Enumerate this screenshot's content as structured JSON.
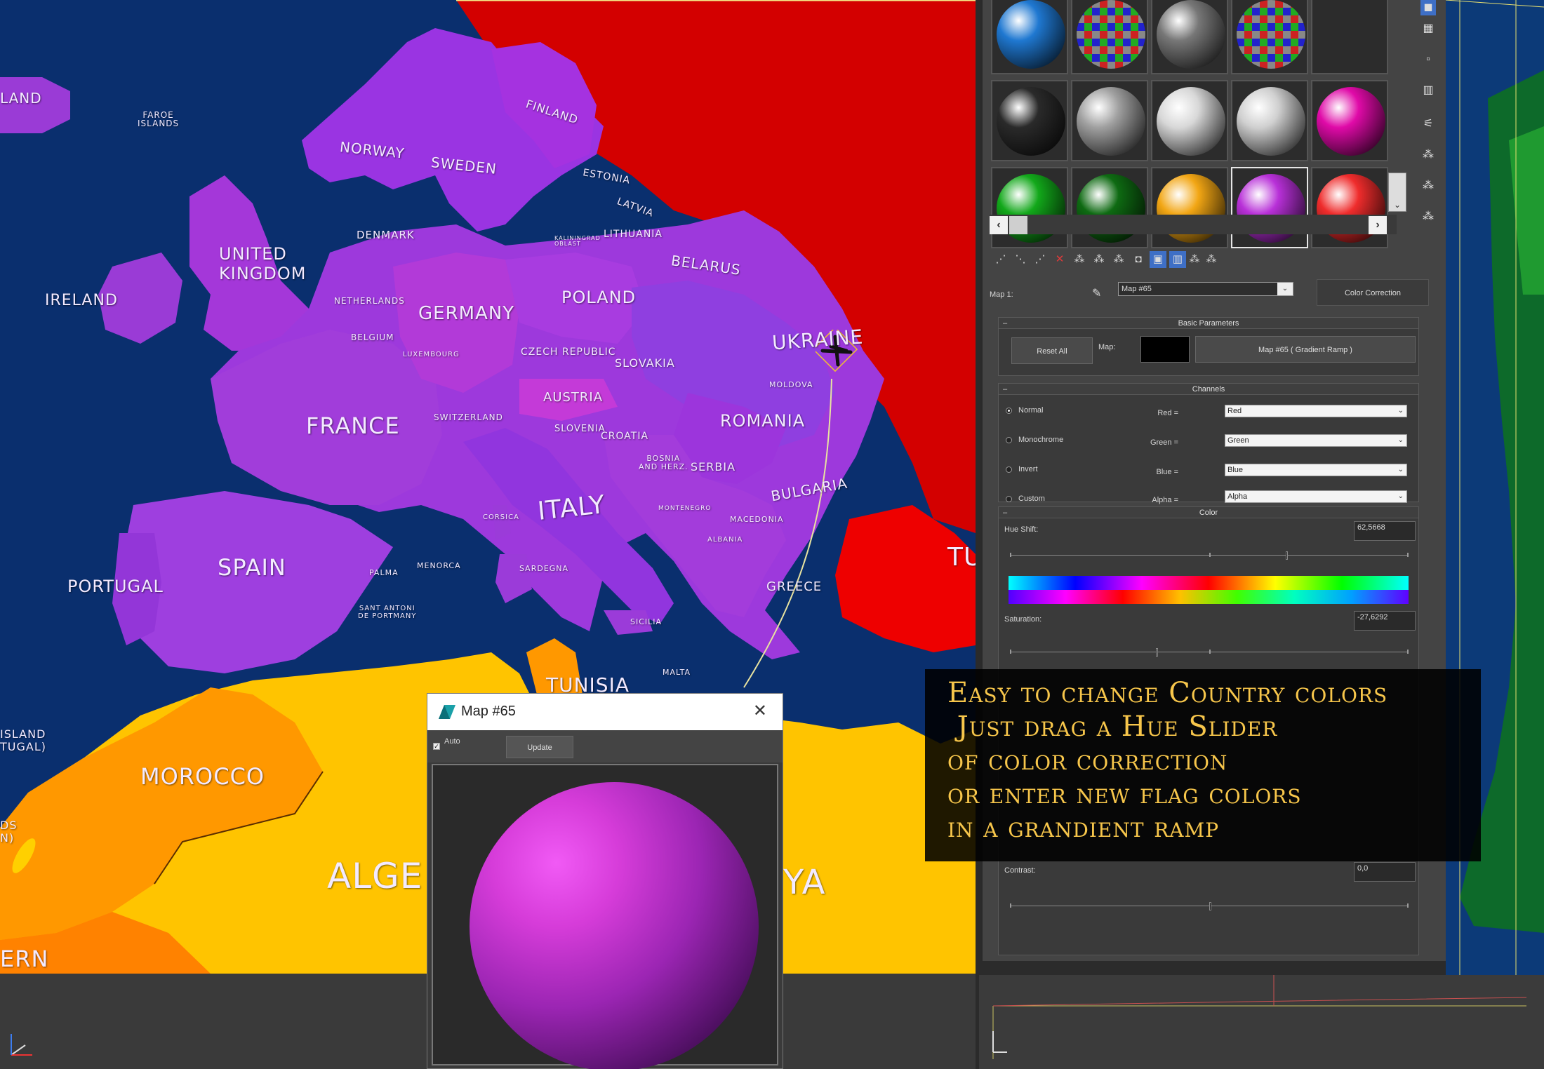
{
  "map": {
    "countries": [
      {
        "id": "iceland",
        "label": "LAND"
      },
      {
        "id": "faroe",
        "label": "FAROE\nISLANDS"
      },
      {
        "id": "norway",
        "label": "NORWAY"
      },
      {
        "id": "sweden",
        "label": "SWEDEN"
      },
      {
        "id": "finland",
        "label": "FINLAND"
      },
      {
        "id": "estonia",
        "label": "ESTONIA"
      },
      {
        "id": "latvia",
        "label": "LATVIA"
      },
      {
        "id": "lithuania",
        "label": "LITHUANIA"
      },
      {
        "id": "kaliningrad",
        "label": "KALININGRAD\nOBLAST"
      },
      {
        "id": "belarus",
        "label": "BELARUS"
      },
      {
        "id": "denmark",
        "label": "DENMARK"
      },
      {
        "id": "uk",
        "label": "UNITED\nKINGDOM"
      },
      {
        "id": "ireland",
        "label": "IRELAND"
      },
      {
        "id": "netherlands",
        "label": "NETHERLANDS"
      },
      {
        "id": "belgium",
        "label": "BELGIUM"
      },
      {
        "id": "luxembourg",
        "label": "LUXEMBOURG"
      },
      {
        "id": "germany",
        "label": "GERMANY"
      },
      {
        "id": "poland",
        "label": "POLAND"
      },
      {
        "id": "ukraine",
        "label": "UKRAINE"
      },
      {
        "id": "czech",
        "label": "CZECH REPUBLIC"
      },
      {
        "id": "slovakia",
        "label": "SLOVAKIA"
      },
      {
        "id": "austria",
        "label": "AUSTRIA"
      },
      {
        "id": "moldova",
        "label": "MOLDOVA"
      },
      {
        "id": "france",
        "label": "FRANCE"
      },
      {
        "id": "switzerland",
        "label": "SWITZERLAND"
      },
      {
        "id": "slovenia",
        "label": "SLOVENIA"
      },
      {
        "id": "croatia",
        "label": "CROATIA"
      },
      {
        "id": "romania",
        "label": "ROMANIA"
      },
      {
        "id": "bosnia",
        "label": "BOSNIA\nAND HERZ."
      },
      {
        "id": "serbia",
        "label": "SERBIA"
      },
      {
        "id": "bulgaria",
        "label": "BULGARIA"
      },
      {
        "id": "montenegro",
        "label": "MONTENEGRO"
      },
      {
        "id": "macedonia",
        "label": "MACEDONIA"
      },
      {
        "id": "albania",
        "label": "ALBANIA"
      },
      {
        "id": "italy",
        "label": "ITALY"
      },
      {
        "id": "corsica",
        "label": "CORSICA"
      },
      {
        "id": "sardegna",
        "label": "SARDEGNA"
      },
      {
        "id": "spain",
        "label": "SPAIN"
      },
      {
        "id": "portugal",
        "label": "PORTUGAL"
      },
      {
        "id": "palma",
        "label": "PALMA"
      },
      {
        "id": "menorca",
        "label": "MENORCA"
      },
      {
        "id": "sant-antoni",
        "label": "SANT ANTONI\nDE PORTMANY"
      },
      {
        "id": "sicilia",
        "label": "SICILIA"
      },
      {
        "id": "greece",
        "label": "GREECE"
      },
      {
        "id": "tunisia",
        "label": "TUNISIA"
      },
      {
        "id": "malta",
        "label": "MALTA"
      },
      {
        "id": "morocco",
        "label": "MOROCCO"
      },
      {
        "id": "algeria",
        "label": "ALGE"
      },
      {
        "id": "libya",
        "label": "YA"
      },
      {
        "id": "turkey",
        "label": "TU"
      },
      {
        "id": "madeira",
        "label": "ISLAND\nTUGAL)"
      },
      {
        "id": "canaries",
        "label": "DS\nN)"
      },
      {
        "id": "western",
        "label": "ERN"
      }
    ]
  },
  "slots": {
    "rows": [
      [
        "#1f78d1",
        "checker",
        "#777777",
        "checker",
        ""
      ],
      [
        "#2a2a2a",
        "#a0a0a0",
        "#d8d8d8",
        "#d0d0d0",
        "#e00aa8"
      ],
      [
        "#12a81a",
        "#0e6a12",
        "#f2a614",
        "#b830d8",
        "#ef2c2c"
      ]
    ]
  },
  "toolbar": {
    "map_label": "Map 1:",
    "map_value": "Map #65",
    "map_type_button": "Color Correction"
  },
  "basic_parameters": {
    "title": "Basic Parameters",
    "reset_all": "Reset All",
    "map_label": "Map:",
    "map_button": "Map #65  ( Gradient Ramp )"
  },
  "channels": {
    "title": "Channels",
    "modes": [
      "Normal",
      "Monochrome",
      "Invert",
      "Custom"
    ],
    "selected_mode": "Normal",
    "rows": [
      {
        "label": "Red =",
        "value": "Red"
      },
      {
        "label": "Green =",
        "value": "Green"
      },
      {
        "label": "Blue =",
        "value": "Blue"
      },
      {
        "label": "Alpha =",
        "value": "Alpha"
      }
    ]
  },
  "color": {
    "title": "Color",
    "hue_shift_label": "Hue Shift:",
    "hue_shift_value": "62,5668",
    "saturation_label": "Saturation:",
    "saturation_value": "-27,6292",
    "contrast_label": "Contrast:",
    "contrast_value": "0,0"
  },
  "promo": {
    "lines": [
      "Easy to change Country colors",
      " Just drag a Hue Slider",
      "of color correction",
      "or enter new flag colors",
      "in a grandient ramp"
    ]
  },
  "preview": {
    "title": "Map #65",
    "auto_label": "Auto",
    "auto_checked": true,
    "update_label": "Update",
    "close_glyph": "✕"
  },
  "colors": {
    "ocean": "#0a2f6e",
    "country_purple": "#9a3bd6",
    "country_magenta": "#b12fd2",
    "russia_red": "#d80000",
    "africa_yellow": "#ffc800",
    "africa_orange": "#ff9a00",
    "promo_text": "#f7c64b"
  }
}
